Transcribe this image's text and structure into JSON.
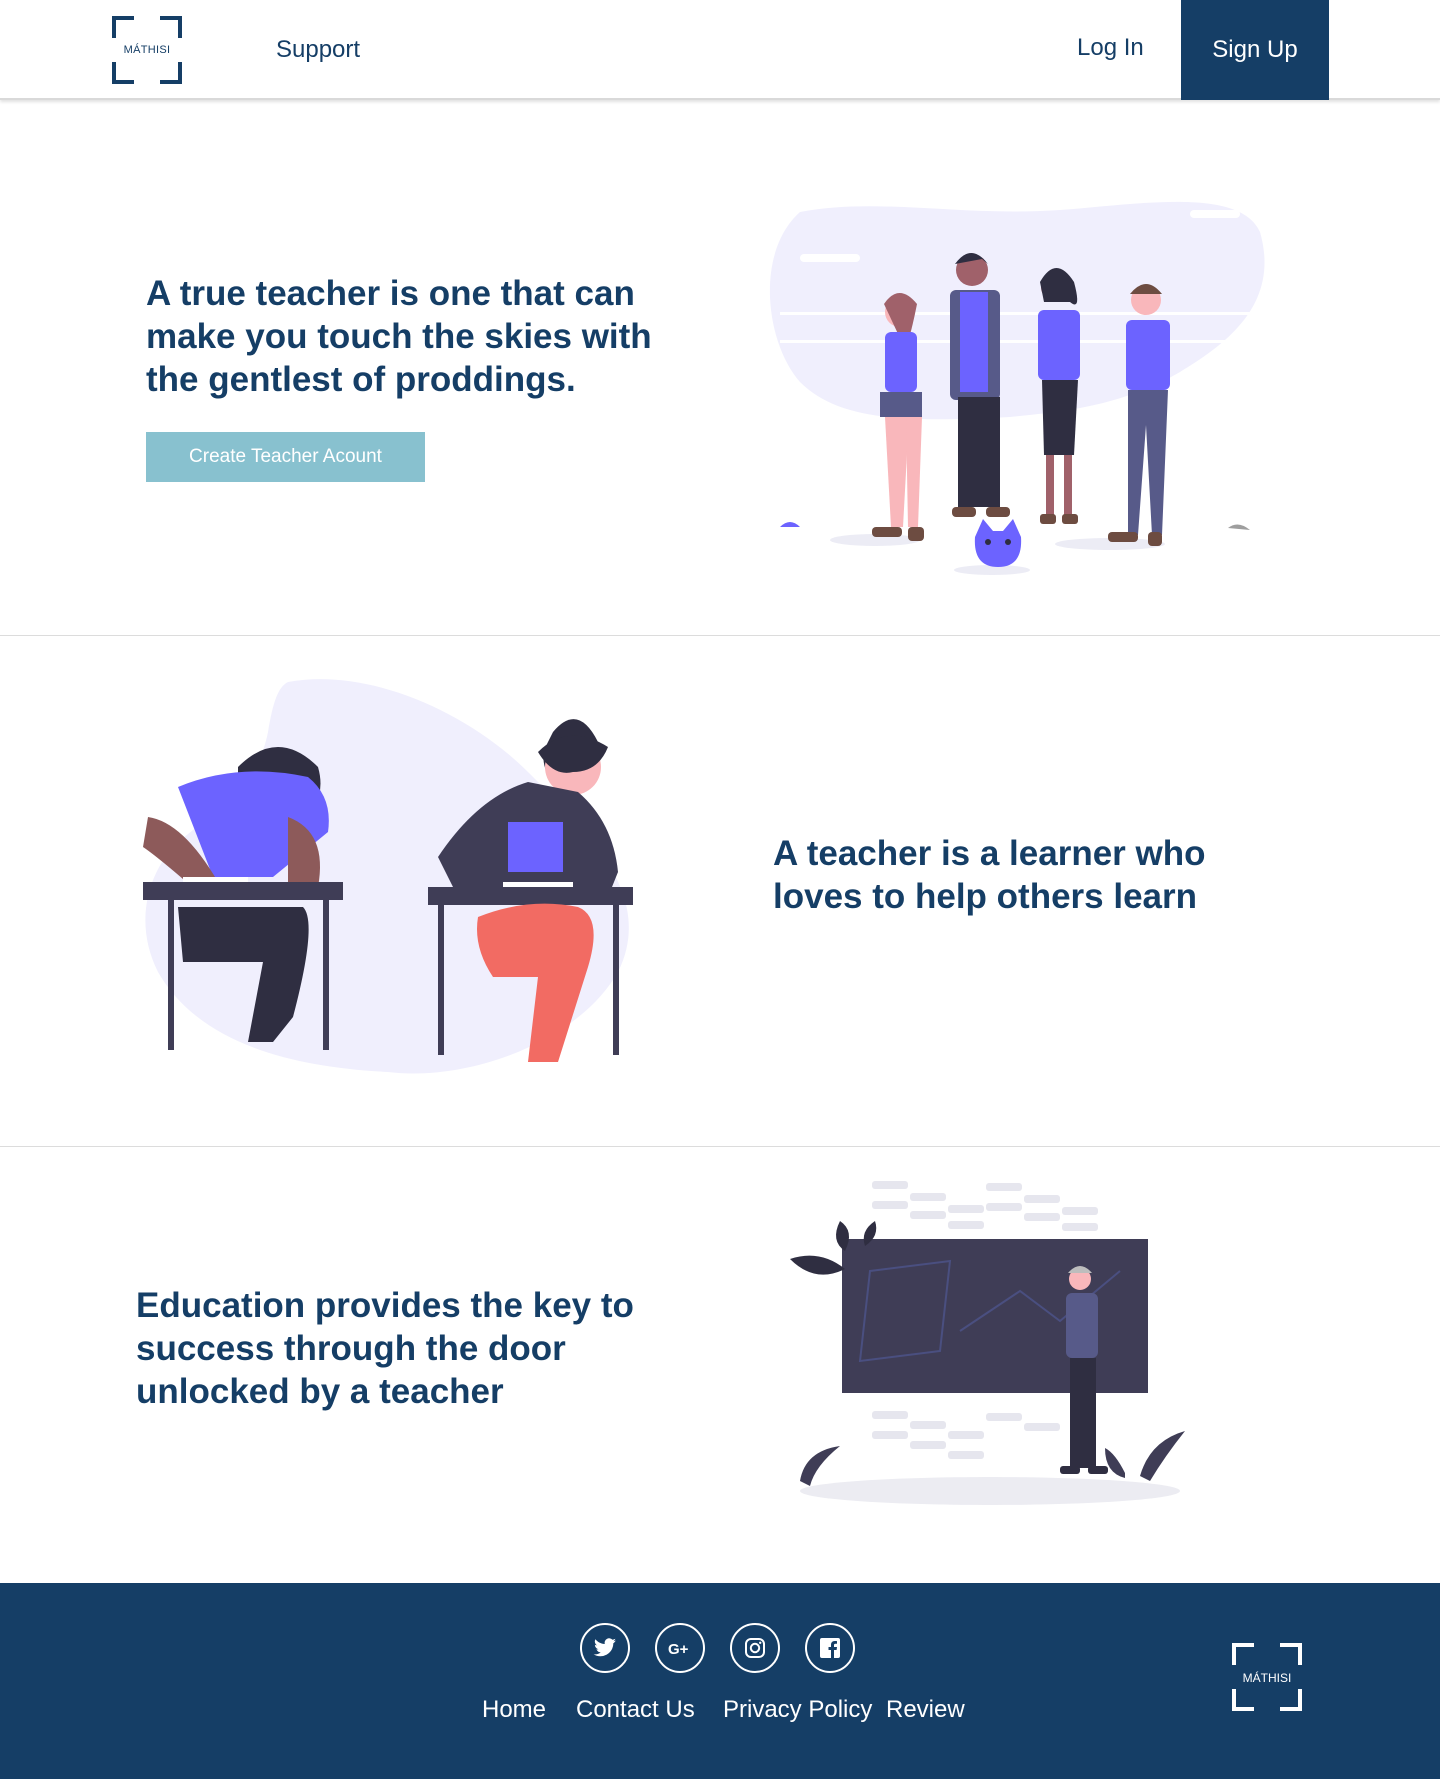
{
  "header": {
    "logo_text": "MÁTHISI",
    "nav": {
      "support": "Support",
      "login": "Log In",
      "signup": "Sign Up"
    }
  },
  "sections": [
    {
      "quote": "A true teacher is one that can make you touch the skies with the gentlest of proddings.",
      "button": "Create Teacher Acount"
    },
    {
      "quote": "A teacher is a learner who loves to help others learn"
    },
    {
      "quote": "Education provides the key to success through the door unlocked by a teacher"
    }
  ],
  "footer": {
    "social_icons": [
      "twitter-icon",
      "google-plus-icon",
      "instagram-icon",
      "facebook-icon"
    ],
    "links": {
      "home": "Home",
      "contact": "Contact Us",
      "privacy": "Privacy Policy",
      "review": "Review"
    },
    "logo_text": "MÁTHISI"
  },
  "colors": {
    "primary": "#153e66",
    "accent_button": "#88c1cf",
    "illustration_purple": "#6c63ff",
    "blob": "#f0effd"
  }
}
